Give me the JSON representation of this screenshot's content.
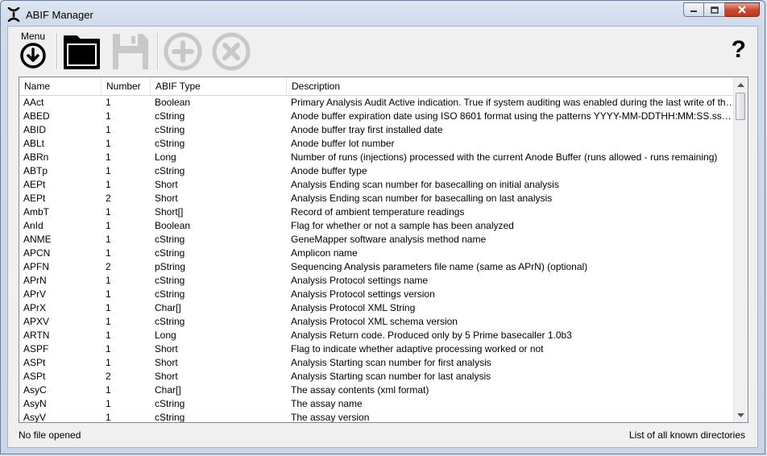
{
  "window": {
    "title": "ABIF Manager",
    "close_color": "#c9452c"
  },
  "toolbar": {
    "menu_label": "Menu",
    "help_label": "?"
  },
  "table": {
    "columns": [
      "Name",
      "Number",
      "ABIF Type",
      "Description"
    ],
    "rows": [
      {
        "name": "AAct",
        "number": "1",
        "type": "Boolean",
        "description": "Primary Analysis Audit Active indication. True if system auditing was enabled during the last write of this file, fals..."
      },
      {
        "name": "ABED",
        "number": "1",
        "type": "cString",
        "description": "Anode buffer expiration date using ISO 8601 format using the patterns YYYY-MM-DDTHH:MM:SS.ss+/-HH:M..."
      },
      {
        "name": "ABID",
        "number": "1",
        "type": "cString",
        "description": "Anode buffer tray first installed date"
      },
      {
        "name": "ABLt",
        "number": "1",
        "type": "cString",
        "description": "Anode buffer lot number"
      },
      {
        "name": "ABRn",
        "number": "1",
        "type": "Long",
        "description": "Number of runs (injections) processed with the current Anode Buffer (runs allowed - runs remaining)"
      },
      {
        "name": "ABTp",
        "number": "1",
        "type": "cString",
        "description": "Anode buffer type"
      },
      {
        "name": "AEPt",
        "number": "1",
        "type": "Short",
        "description": "Analysis Ending scan number for basecalling on initial analysis"
      },
      {
        "name": "AEPt",
        "number": "2",
        "type": "Short",
        "description": "Analysis Ending scan number for basecalling on last analysis"
      },
      {
        "name": "AmbT",
        "number": "1",
        "type": "Short[]",
        "description": "Record of ambient temperature readings"
      },
      {
        "name": "AnId",
        "number": "1",
        "type": "Boolean",
        "description": "Flag for whether or not a sample has been analyzed"
      },
      {
        "name": "ANME",
        "number": "1",
        "type": "cString",
        "description": "GeneMapper software analysis method name"
      },
      {
        "name": "APCN",
        "number": "1",
        "type": "cString",
        "description": "Amplicon name"
      },
      {
        "name": "APFN",
        "number": "2",
        "type": "pString",
        "description": "Sequencing Analysis parameters file name (same as APrN) (optional)"
      },
      {
        "name": "APrN",
        "number": "1",
        "type": "cString",
        "description": "Analysis Protocol settings name"
      },
      {
        "name": "APrV",
        "number": "1",
        "type": "cString",
        "description": "Analysis Protocol settings version"
      },
      {
        "name": "APrX",
        "number": "1",
        "type": "Char[]",
        "description": "Analysis Protocol XML String"
      },
      {
        "name": "APXV",
        "number": "1",
        "type": "cString",
        "description": "Analysis Protocol XML schema version"
      },
      {
        "name": "ARTN",
        "number": "1",
        "type": "Long",
        "description": "Analysis Return code. Produced only by 5 Prime basecaller 1.0b3"
      },
      {
        "name": "ASPF",
        "number": "1",
        "type": "Short",
        "description": "Flag to indicate whether adaptive processing worked or not"
      },
      {
        "name": "ASPt",
        "number": "1",
        "type": "Short",
        "description": "Analysis Starting scan number for first analysis"
      },
      {
        "name": "ASPt",
        "number": "2",
        "type": "Short",
        "description": "Analysis Starting scan number for last analysis"
      },
      {
        "name": "AsyC",
        "number": "1",
        "type": "Char[]",
        "description": "The assay contents (xml format)"
      },
      {
        "name": "AsyN",
        "number": "1",
        "type": "cString",
        "description": "The assay name"
      },
      {
        "name": "AsyV",
        "number": "1",
        "type": "cString",
        "description": "The assay version"
      }
    ]
  },
  "status": {
    "left": "No file opened",
    "right": "List of all known directories"
  }
}
